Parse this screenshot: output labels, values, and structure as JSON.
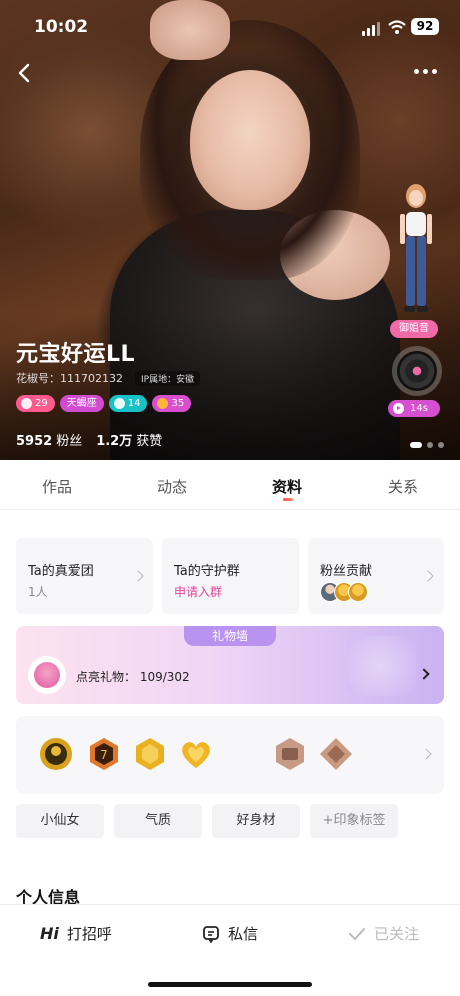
{
  "status_bar": {
    "time": "10:02",
    "battery": "92"
  },
  "profile": {
    "name": "元宝好运LL",
    "id_label": "花椒号：111702132",
    "ip_label": "IP属地：安徽",
    "badges": [
      {
        "text": "29",
        "color": "#ff5a8e"
      },
      {
        "text": "天蝎座",
        "color": "#d04bd0"
      },
      {
        "text": "14",
        "color": "#19c2c7"
      },
      {
        "text": "35",
        "color": "#d94fd0"
      }
    ],
    "fans_count": "5952",
    "fans_label": "粉丝",
    "likes_count": "1.2万",
    "likes_label": "获赞",
    "sing_tag": "御姐音",
    "voice_duration": "14s"
  },
  "tabs": [
    {
      "label": "作品",
      "active": false
    },
    {
      "label": "动态",
      "active": false
    },
    {
      "label": "资料",
      "active": true
    },
    {
      "label": "关系",
      "active": false
    }
  ],
  "cards": {
    "fan_club": {
      "title": "Ta的真爱团",
      "sub": "1人"
    },
    "guard_group": {
      "title": "Ta的守护群",
      "sub": "申请入群"
    },
    "fan_contrib": {
      "title": "粉丝贡献"
    }
  },
  "gift_wall": {
    "header": "礼物墙",
    "progress_text": "点亮礼物： 109/302"
  },
  "tags": [
    {
      "label": "小仙女"
    },
    {
      "label": "气质"
    },
    {
      "label": "好身材"
    },
    {
      "label": "+印象标签"
    }
  ],
  "section_title": "个人信息",
  "bottom": {
    "greet": "打招呼",
    "greet_prefix": "Hi",
    "message": "私信",
    "followed": "已关注"
  },
  "colors": {
    "accent_pink": "#e0479e",
    "gift_header": "#b993ef"
  }
}
